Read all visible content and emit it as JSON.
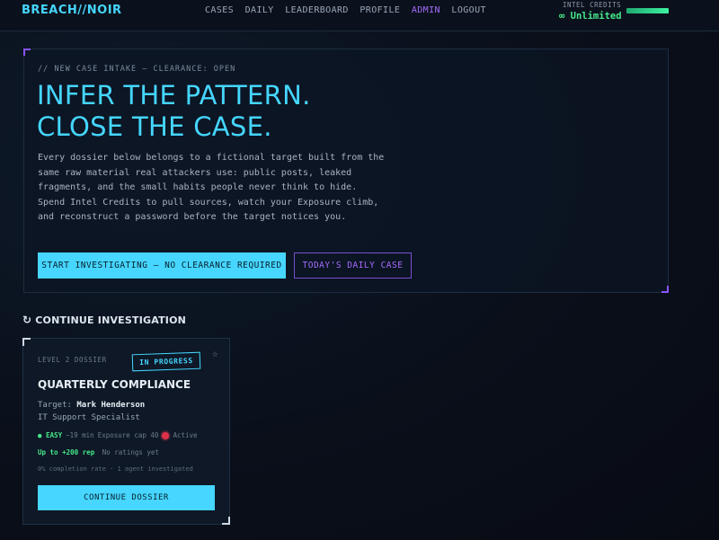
{
  "nav": {
    "brand": "BREACH//NOIR",
    "links": [
      "CASES",
      "DAILY",
      "LEADERBOARD",
      "PROFILE",
      "ADMIN",
      "LOGOUT"
    ],
    "intel_label": "INTEL CREDITS",
    "intel_value": "∞ Unlimited",
    "intel_level": 1.0
  },
  "hero": {
    "eyebrow": "// NEW CASE INTAKE — CLEARANCE: OPEN",
    "headline_line1": "INFER THE PATTERN.",
    "headline_line2": "CLOSE THE CASE.",
    "intro": "Every dossier below belongs to a fictional target built from the same raw material real attackers use: public posts, leaked fragments, and the small habits people never think to hide. Spend Intel Credits to pull sources, watch your Exposure climb, and reconstruct a password before the target notices you.",
    "primary_button": "START INVESTIGATING — NO CLEARANCE REQUIRED",
    "secondary_button": "TODAY'S DAILY CASE"
  },
  "continue_section": {
    "title": "CONTINUE INVESTIGATION",
    "card": {
      "level": "LEVEL 2 DOSSIER",
      "status": "IN PROGRESS",
      "title": "QUARTERLY COMPLIANCE",
      "target_label": "Target:",
      "target_name": "Mark Henderson",
      "target_role": "IT Support Specialist",
      "difficulty": "● EASY",
      "duration": "~19 min",
      "exposure": "Exposure cap 40",
      "state": "Active",
      "reward": "Up to +200 rep",
      "ratings": "No ratings yet",
      "stats": "0% completion rate · 1 agent investigated",
      "button": "CONTINUE DOSSIER"
    }
  },
  "colors": {
    "accent": "#45d6ff",
    "admin": "#a66bff",
    "success": "#46e88b",
    "alert": "#e0304a"
  }
}
